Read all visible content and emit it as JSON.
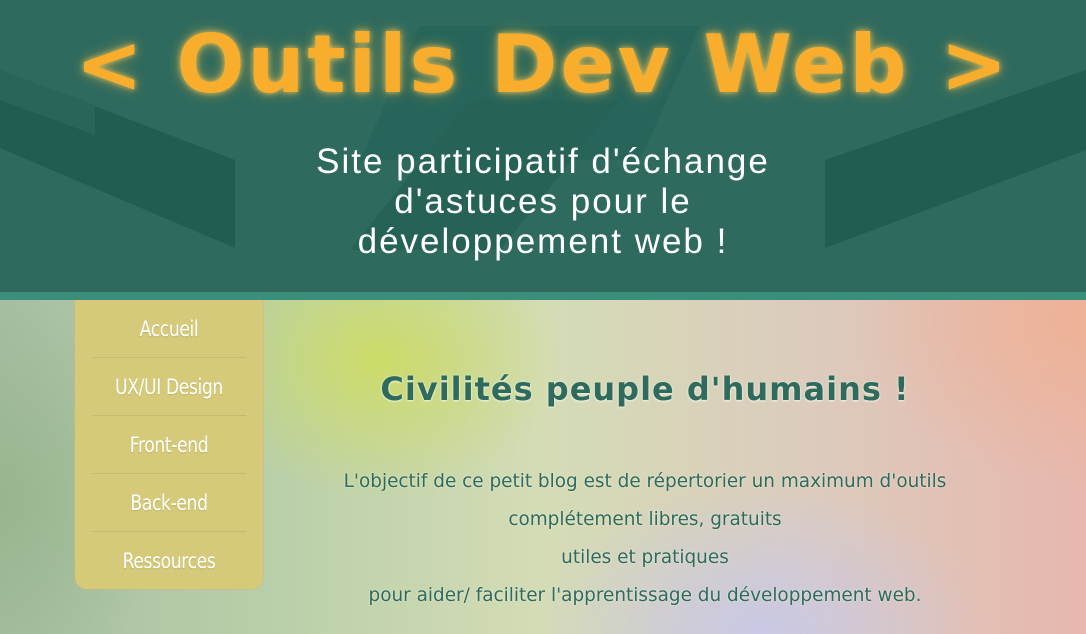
{
  "header": {
    "title": "< Outils Dev Web >",
    "tagline_lines": [
      "Site participatif d'échange",
      "d'astuces pour le",
      "développement web !"
    ],
    "colors": {
      "background": "#2e6a5e",
      "title": "#f8ae2c",
      "tagline": "#ffffff"
    }
  },
  "nav": {
    "items": [
      {
        "label": "Accueil"
      },
      {
        "label": "UX/UI Design"
      },
      {
        "label": "Front-end"
      },
      {
        "label": "Back-end"
      },
      {
        "label": "Ressources"
      }
    ],
    "colors": {
      "background": "#d6ca7a",
      "text": "#ffffff"
    }
  },
  "main": {
    "title": "Civilités peuple d'humains !",
    "intro_lines": [
      "L'objectif de ce petit blog est de répertorier un maximum d'outils",
      "complétement libres, gratuits",
      "utiles et pratiques",
      "pour aider/ faciliter l'apprentissage du développement web."
    ],
    "colors": {
      "text": "#2e6a5e"
    }
  }
}
